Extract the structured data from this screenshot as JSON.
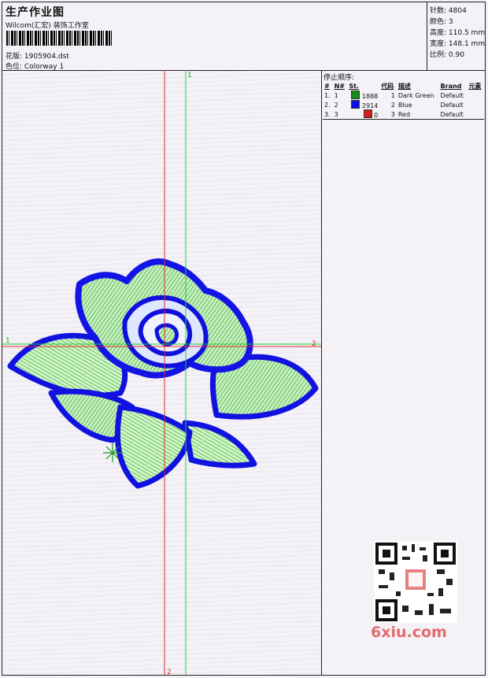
{
  "header": {
    "title": "生产作业图",
    "studio": "Wilcom(汇宏) 装饰工作室",
    "file_label": "花版:",
    "file_name": "1905904.dst",
    "colorway_label": "色位:",
    "colorway": "Colorway 1"
  },
  "stats": [
    {
      "label": "针数:",
      "value": "4804"
    },
    {
      "label": "颜色:",
      "value": "3"
    },
    {
      "label": "高度:",
      "value": "110.5 mm"
    },
    {
      "label": "宽度:",
      "value": "148.1 mm"
    },
    {
      "label": "比例:",
      "value": "0.90"
    }
  ],
  "axes": {
    "v1": "1",
    "h1": "1",
    "h2": "2",
    "v2": "2"
  },
  "stop_sequence": {
    "title": "停止顺序:",
    "columns": [
      "#",
      "N#",
      "St.",
      "代码",
      "描述",
      "Brand",
      "元素"
    ],
    "rows": [
      {
        "idx": "1.",
        "n": "1",
        "color": "#1a8a1a",
        "st": "1888",
        "code": "1",
        "desc": "Dark Green",
        "brand": "Default"
      },
      {
        "idx": "2.",
        "n": "2",
        "color": "#1010dd",
        "st": "2914",
        "code": "2",
        "desc": "Blue",
        "brand": "Default"
      },
      {
        "idx": "3.",
        "n": "3",
        "color": "#dd1a1a",
        "st": "0",
        "code": "3",
        "desc": "Red",
        "brand": "Default"
      }
    ]
  },
  "watermark": {
    "site": "6xiu.com"
  }
}
